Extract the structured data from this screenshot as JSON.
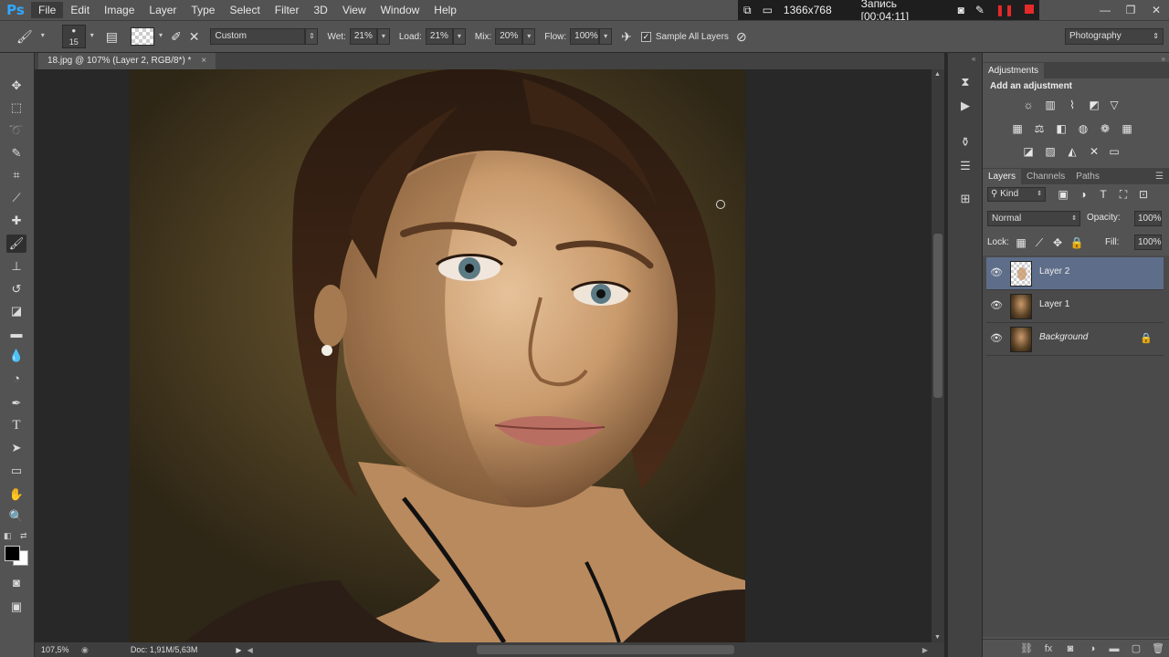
{
  "app": {
    "logo": "Ps"
  },
  "menu": [
    "File",
    "Edit",
    "Image",
    "Layer",
    "Type",
    "Select",
    "Filter",
    "3D",
    "View",
    "Window",
    "Help"
  ],
  "recorder": {
    "resolution": "1366x768",
    "status": "Запись [00:04:11]"
  },
  "options_bar": {
    "brush_size": "15",
    "mix_preset": "Custom",
    "wet_label": "Wet:",
    "wet_value": "21%",
    "load_label": "Load:",
    "load_value": "21%",
    "mix_label": "Mix:",
    "mix_value": "20%",
    "flow_label": "Flow:",
    "flow_value": "100%",
    "sample_all_layers": "Sample All Layers",
    "workspace": "Photography"
  },
  "document": {
    "tab_title": "18.jpg @ 107% (Layer 2, RGB/8*) *",
    "close": "×"
  },
  "status_bar": {
    "zoom": "107,5%",
    "doc_info": "Doc: 1,91M/5,63M"
  },
  "adjustments": {
    "tab": "Adjustments",
    "heading": "Add an adjustment"
  },
  "layers_panel": {
    "tabs": [
      "Layers",
      "Channels",
      "Paths"
    ],
    "filter_kind": "Kind",
    "blend_mode": "Normal",
    "opacity_label": "Opacity:",
    "opacity_value": "100%",
    "lock_label": "Lock:",
    "fill_label": "Fill:",
    "fill_value": "100%",
    "layers": [
      {
        "name": "Layer 2"
      },
      {
        "name": "Layer 1"
      },
      {
        "name": "Background"
      }
    ]
  },
  "colors": {
    "chrome": "#535353",
    "dark_chrome": "#424242",
    "selected_layer": "#5e6e8a",
    "ps_blue": "#31a8ff"
  }
}
